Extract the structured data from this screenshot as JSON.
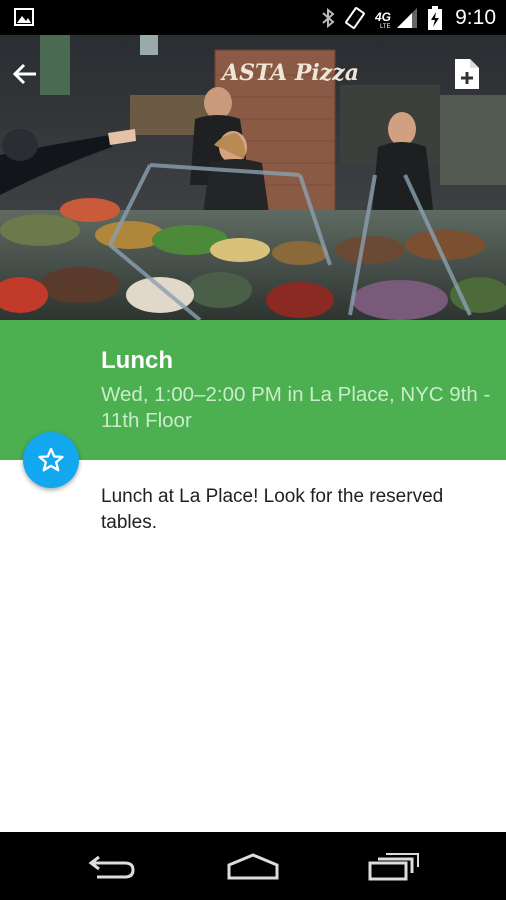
{
  "status_bar": {
    "time": "9:10",
    "network": "4G LTE",
    "icons": [
      "gallery-icon",
      "bluetooth-icon",
      "vibrate-icon",
      "signal-icon",
      "battery-charging-icon"
    ]
  },
  "toolbar": {
    "back_icon": "arrow-back-icon",
    "action_icon": "add-to-calendar-icon"
  },
  "session": {
    "title": "Lunch",
    "subtitle": "Wed, 1:00–2:00 PM in La Place, NYC 9th - 11th Floor",
    "description": "Lunch at La Place! Look for the reserved tables."
  },
  "hero_sign": "ASTA Pizza",
  "fab_icon": "star-outline-icon",
  "colors": {
    "header_green": "#4caf50",
    "fab_blue": "#12a7ef",
    "subtitle_text": "#c9eccb"
  },
  "nav_bar": {
    "icons": [
      "back-nav-icon",
      "home-nav-icon",
      "recents-nav-icon"
    ]
  }
}
